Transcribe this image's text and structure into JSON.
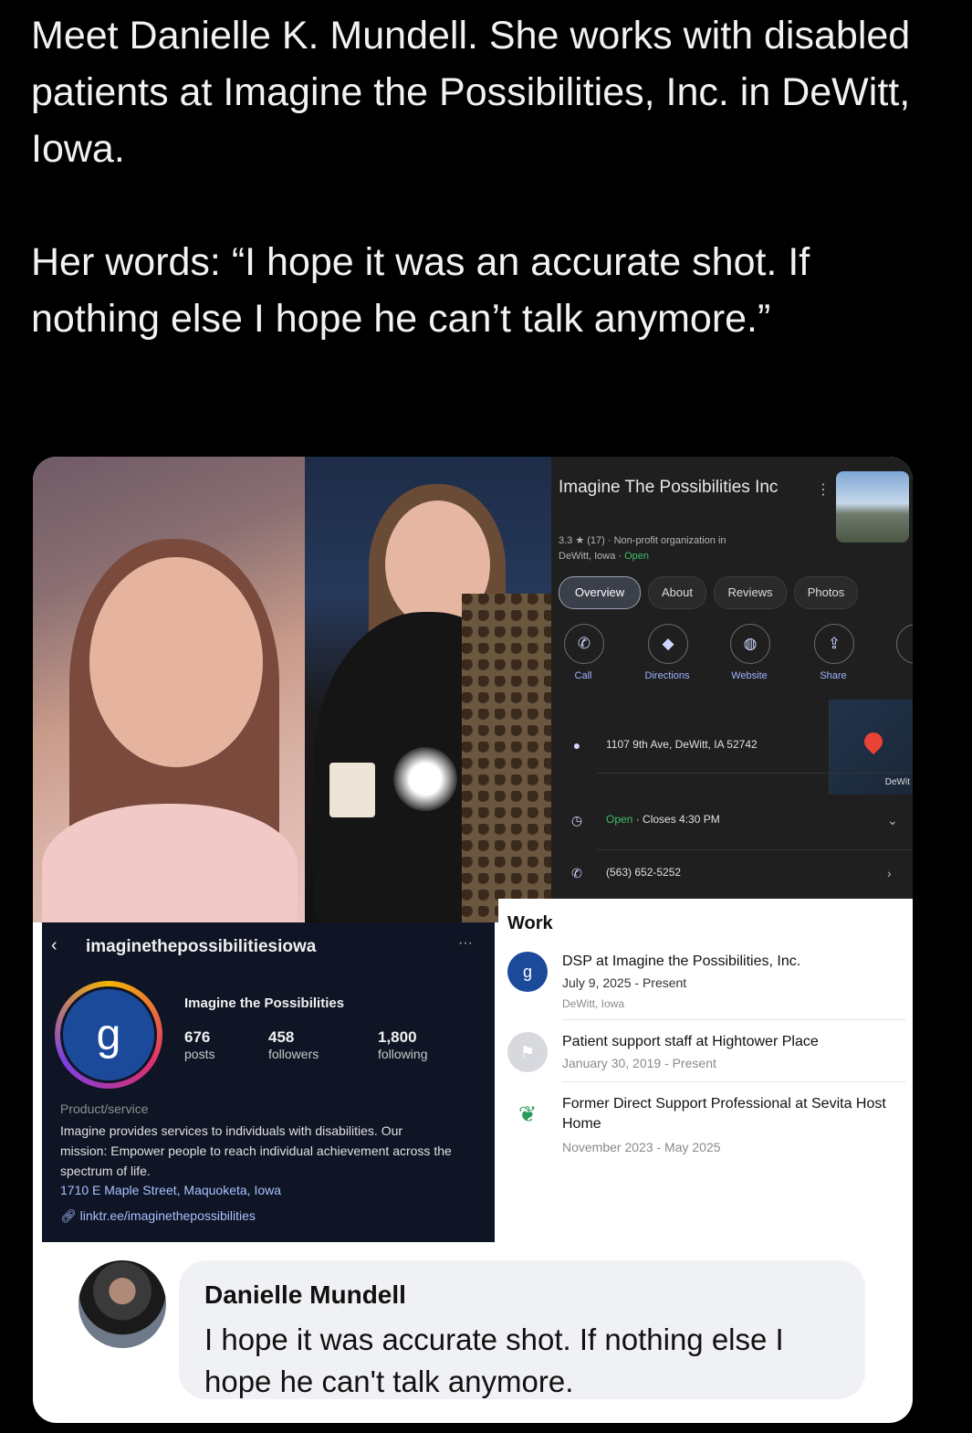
{
  "tweet": {
    "text": "Meet Danielle K. Mundell. She works with disabled patients at Imagine the Possibilities, Inc. in DeWitt, Iowa.\n\nHer words: “I hope it was an accurate shot. If nothing else I hope he can’t talk anymore.”"
  },
  "maps": {
    "title": "Imagine The Possibilities Inc",
    "rating_line": "3.3 ★ (17) · Non-profit organization in",
    "location_line": "DeWitt, Iowa · ",
    "open_label": "Open",
    "tabs": [
      "Overview",
      "About",
      "Reviews",
      "Photos"
    ],
    "actions": [
      {
        "label": "Call",
        "icon": "phone-icon"
      },
      {
        "label": "Directions",
        "icon": "directions-icon"
      },
      {
        "label": "Website",
        "icon": "globe-icon"
      },
      {
        "label": "Share",
        "icon": "share-icon"
      }
    ],
    "address": "1107 9th Ave, DeWitt, IA 52742",
    "hours_open": "Open",
    "hours_close": " · Closes 4:30 PM",
    "phone": "(563) 652-5252",
    "map_city": "DeWit"
  },
  "instagram": {
    "username": "imaginethepossibilitiesiowa",
    "display_name": "Imagine the Possibilities",
    "stats": [
      {
        "num": "676",
        "label": "posts"
      },
      {
        "num": "458",
        "label": "followers"
      },
      {
        "num": "1,800",
        "label": "following"
      }
    ],
    "category": "Product/service",
    "bio": "Imagine provides services to individuals with disabilities. Our mission: Empower people to reach individual achievement across the spectrum of life.",
    "address": "1710 E Maple Street, Maquoketa, Iowa",
    "link": "linktr.ee/imaginethepossibilities"
  },
  "work": {
    "heading": "Work",
    "items": [
      {
        "title": "DSP at Imagine the Possibilities, Inc.",
        "dates": "July 9, 2025 - Present",
        "location": "DeWitt, Iowa"
      },
      {
        "title": "Patient support staff at Hightower Place",
        "dates": "January 30, 2019 - Present"
      },
      {
        "title": "Former Direct Support Professional at Sevita Host Home",
        "dates": "November 2023 - May 2025"
      }
    ]
  },
  "comment": {
    "name": "Danielle Mundell",
    "text": "I hope it was accurate shot. If nothing else I hope he can't talk anymore."
  },
  "colors": {
    "maps_bg": "#1f1f1f",
    "open_green": "#3fbf6a",
    "insta_bg": "#0f1525",
    "link_blue": "#a9c0ff"
  }
}
